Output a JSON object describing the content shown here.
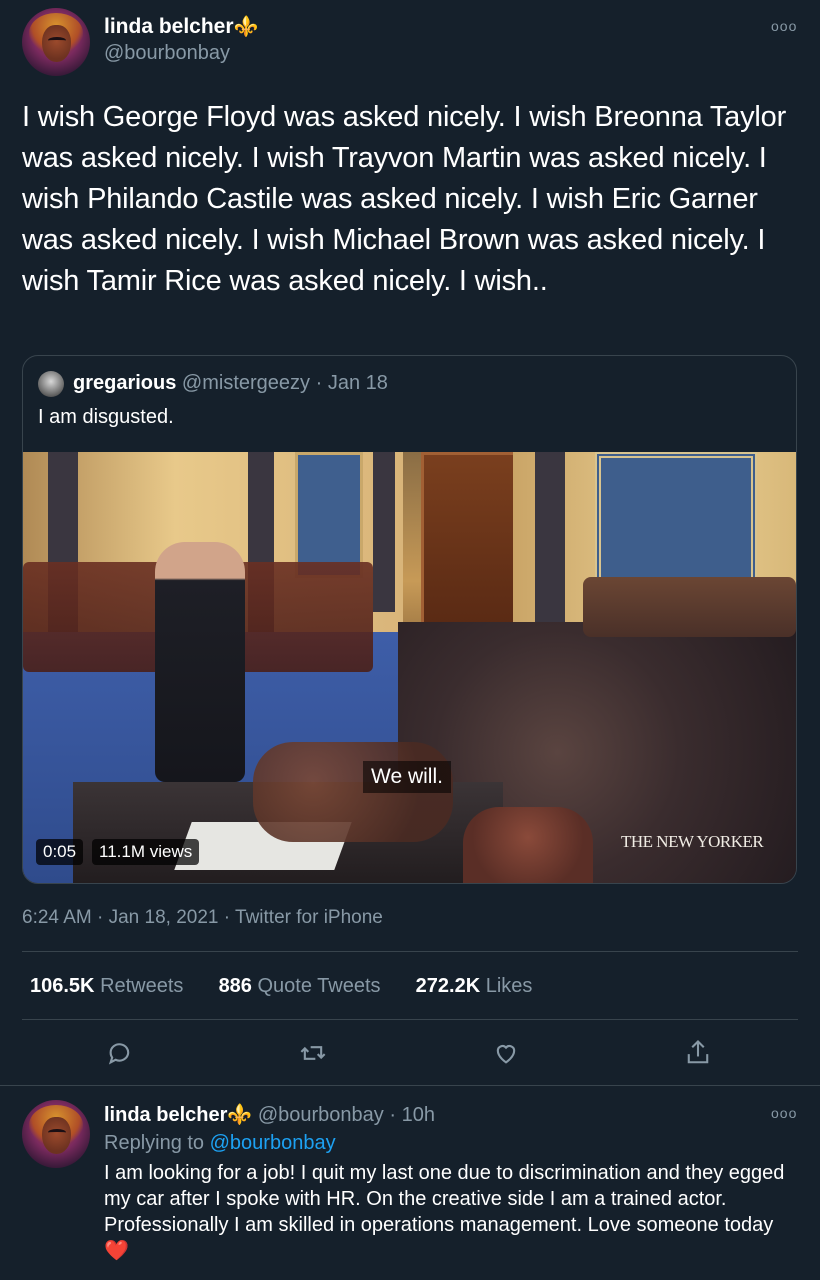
{
  "main_tweet": {
    "name": "linda belcher",
    "name_emoji": "⚜️",
    "handle": "@bourbonbay",
    "more_label": "ooo",
    "text": "I wish George Floyd was asked nicely. I wish Breonna Taylor was asked nicely. I wish Trayvon Martin was asked nicely. I wish Philando Castile was asked nicely. I wish Eric Garner was asked nicely. I wish Michael Brown was asked nicely. I wish Tamir Rice was asked nicely. I wish..",
    "quoted": {
      "name": "gregarious",
      "handle": "@mistergeezy",
      "separator": "·",
      "date": "Jan 18",
      "text": "I am disgusted.",
      "video": {
        "caption": "We will.",
        "watermark": "THE NEW YORKER",
        "time": "0:05",
        "views": "11.1M views"
      }
    },
    "timestamp": "6:24 AM · Jan 18, 2021 · Twitter for iPhone",
    "stats": {
      "retweets_count": "106.5K",
      "retweets_label": "Retweets",
      "quotes_count": "886",
      "quotes_label": "Quote Tweets",
      "likes_count": "272.2K",
      "likes_label": "Likes"
    },
    "actions": [
      "reply-icon",
      "retweet-icon",
      "like-icon",
      "share-icon"
    ]
  },
  "reply_tweet": {
    "name": "linda belcher",
    "name_emoji": "⚜️",
    "handle": "@bourbonbay",
    "separator": "·",
    "time_ago": "10h",
    "more_label": "ooo",
    "replying_label": "Replying to",
    "replying_to": "@bourbonbay",
    "text": "I am looking for a job! I quit my last one due to discrimination and they egged my car after I spoke with HR. On the creative side I am a trained actor. Professionally I am skilled in operations management. Love someone today",
    "end_emoji": "❤️"
  },
  "colors": {
    "background": "#15202b",
    "text": "#ffffff",
    "secondary": "#8899a6",
    "border": "#38444d",
    "link": "#1da1f2",
    "heart": "#e0245e"
  }
}
